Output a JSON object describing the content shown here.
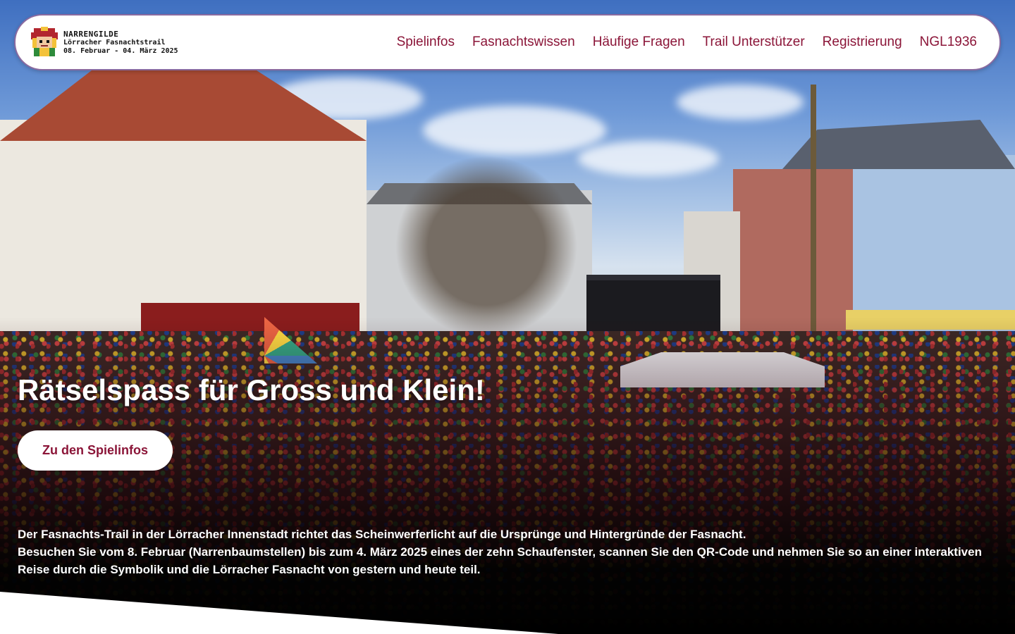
{
  "header": {
    "brand_title": "NARRENGILDE",
    "brand_subtitle": "Lörracher Fasnachtstrail",
    "brand_dates": "08. Februar - 04. März 2025",
    "logo_icon": "jester-mascot-icon",
    "nav": [
      {
        "label": "Spielinfos"
      },
      {
        "label": "Fasnachtswissen"
      },
      {
        "label": "Häufige Fragen"
      },
      {
        "label": "Trail Unterstützer"
      },
      {
        "label": "Registrierung"
      },
      {
        "label": "NGL1936"
      }
    ]
  },
  "hero": {
    "headline": "Rätselspass für Gross und Klein!",
    "cta_label": "Zu den Spielinfos",
    "intro_line1": "Der Fasnachts-Trail in der Lörracher Innenstadt richtet das Scheinwerferlicht auf die Ursprünge und Hintergründe der Fasnacht.",
    "intro_line2": "Besuchen Sie vom 8. Februar (Narrenbaumstellen) bis zum 4. März 2025 eines der zehn Schaufenster, scannen Sie den QR-Code und nehmen Sie so an einer interaktiven Reise durch die Symbolik und die Lörracher Fasnacht von gestern und heute teil."
  },
  "colors": {
    "accent": "#8b1538",
    "navbar_bg": "#ffffff",
    "navbar_border": "#8a6aa0"
  }
}
